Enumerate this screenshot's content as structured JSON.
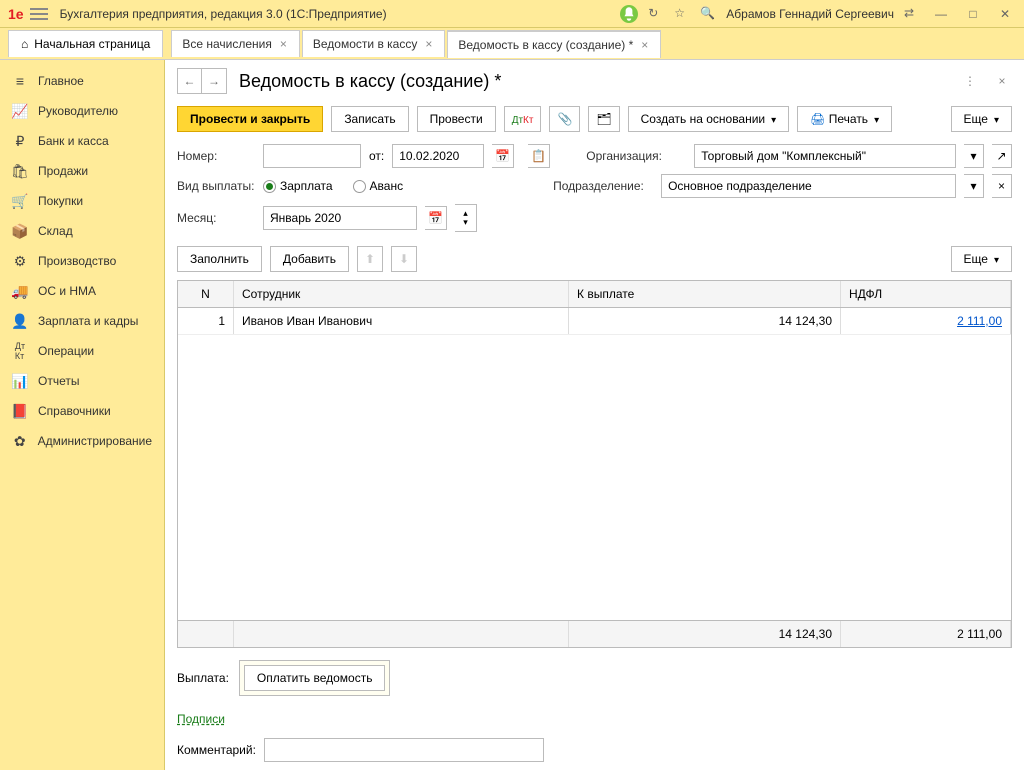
{
  "app": {
    "title": "Бухгалтерия предприятия, редакция 3.0  (1С:Предприятие)",
    "user": "Абрамов Геннадий Сергеевич"
  },
  "tabs": {
    "home": "Начальная страница",
    "items": [
      {
        "label": "Все начисления"
      },
      {
        "label": "Ведомости в кассу"
      },
      {
        "label": "Ведомость в кассу (создание) *"
      }
    ]
  },
  "sidebar": [
    {
      "label": "Главное"
    },
    {
      "label": "Руководителю"
    },
    {
      "label": "Банк и касса"
    },
    {
      "label": "Продажи"
    },
    {
      "label": "Покупки"
    },
    {
      "label": "Склад"
    },
    {
      "label": "Производство"
    },
    {
      "label": "ОС и НМА"
    },
    {
      "label": "Зарплата и кадры"
    },
    {
      "label": "Операции"
    },
    {
      "label": "Отчеты"
    },
    {
      "label": "Справочники"
    },
    {
      "label": "Администрирование"
    }
  ],
  "page": {
    "title": "Ведомость в кассу (создание) *"
  },
  "toolbar": {
    "approve": "Провести и закрыть",
    "write": "Записать",
    "post": "Провести",
    "createBasedOn": "Создать на основании",
    "print": "Печать",
    "more": "Еще"
  },
  "form": {
    "numberLabel": "Номер:",
    "number": "",
    "dateFromLabel": "от:",
    "dateFrom": "10.02.2020",
    "orgLabel": "Организация:",
    "org": "Торговый дом \"Комплексный\"",
    "payTypeLabel": "Вид выплаты:",
    "payTypeSalary": "Зарплата",
    "payTypeAdvance": "Аванс",
    "depLabel": "Подразделение:",
    "dep": "Основное подразделение",
    "monthLabel": "Месяц:",
    "month": "Январь 2020"
  },
  "tableToolbar": {
    "fill": "Заполнить",
    "add": "Добавить",
    "more": "Еще"
  },
  "table": {
    "headers": {
      "n": "N",
      "employee": "Сотрудник",
      "toPay": "К выплате",
      "ndfl": "НДФЛ"
    },
    "rows": [
      {
        "n": "1",
        "employee": "Иванов Иван Иванович",
        "toPay": "14 124,30",
        "ndfl": "2 111,00"
      }
    ],
    "totals": {
      "toPay": "14 124,30",
      "ndfl": "2 111,00"
    }
  },
  "payout": {
    "label": "Выплата:",
    "button": "Оплатить ведомость"
  },
  "signatures": "Подписи",
  "comment": {
    "label": "Комментарий:",
    "value": ""
  }
}
